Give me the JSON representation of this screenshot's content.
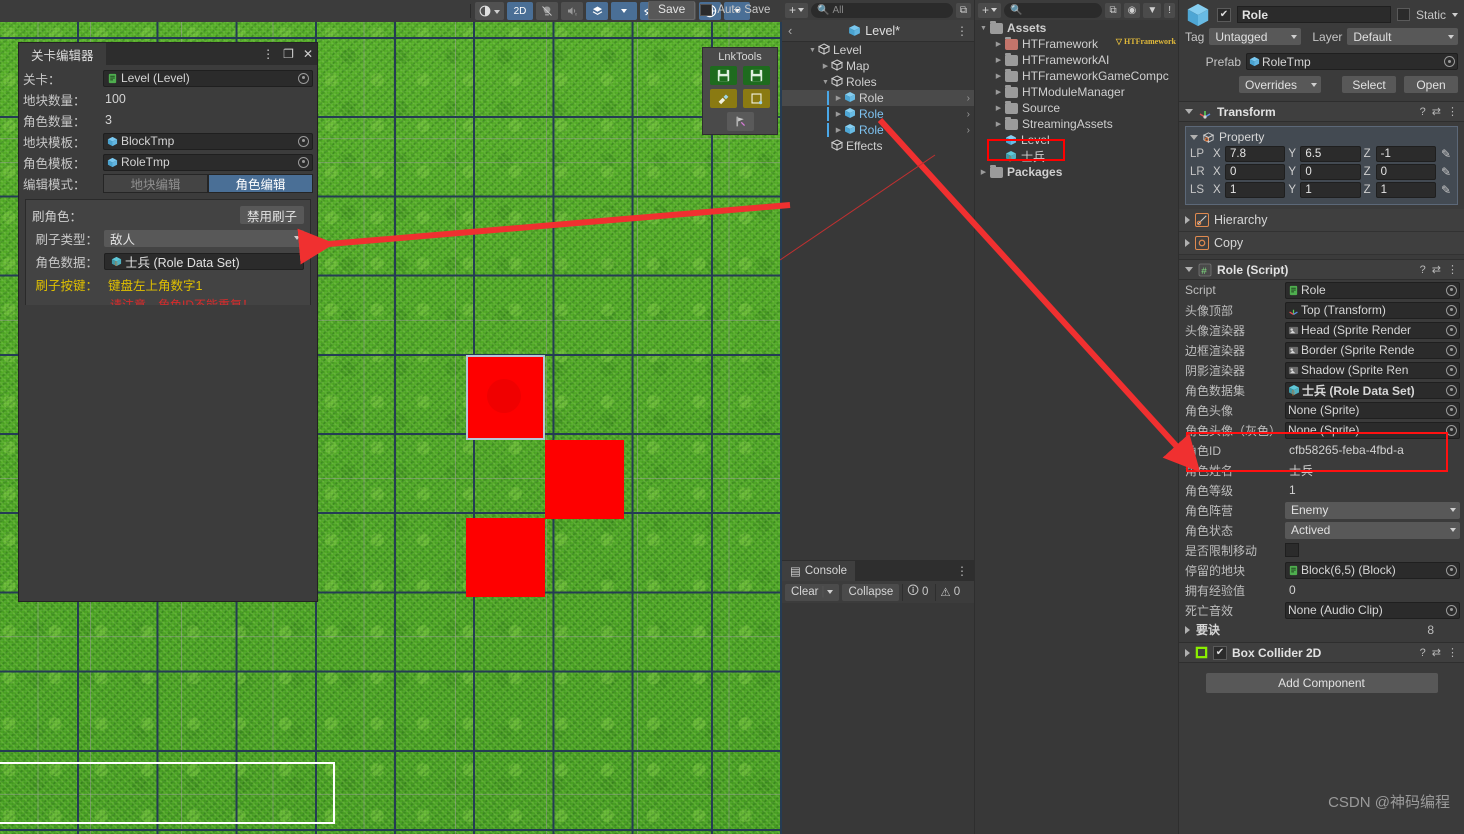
{
  "scene_toolbar": {
    "save_label": "Save",
    "autosave_label": "Auto Save",
    "mode_2d": "2D",
    "buttons": [
      "light-toggle",
      "audio-toggle",
      "effects-toggle",
      "visibility-toggle",
      "camera-toggle",
      "gizmos-toggle"
    ]
  },
  "lnktools": {
    "title": "LnkTools",
    "buttons": [
      "save-icon",
      "save-as-icon",
      "brush-icon",
      "frame-icon",
      "flag-icon"
    ]
  },
  "level_editor": {
    "title": "关卡编辑器",
    "window_controls": [
      "more-menu-icon",
      "maximize-icon",
      "close-icon"
    ],
    "fields": [
      {
        "label": "关卡：",
        "value": "Level (Level)",
        "type": "object",
        "icon": "script-icon"
      },
      {
        "label": "地块数量：",
        "value": "100",
        "type": "text"
      },
      {
        "label": "角色数量：",
        "value": "3",
        "type": "text"
      },
      {
        "label": "地块模板：",
        "value": "BlockTmp",
        "type": "object",
        "icon": "prefab-icon"
      },
      {
        "label": "角色模板：",
        "value": "RoleTmp",
        "type": "object",
        "icon": "prefab-icon"
      }
    ],
    "edit_mode_label": "编辑模式：",
    "mode_tile": "地块编辑",
    "mode_role": "角色编辑",
    "brush": {
      "title": "刷角色：",
      "disable_button": "禁用刷子",
      "type_label": "刷子类型：",
      "type_value": "敌人",
      "data_label": "角色数据：",
      "data_value": "士兵 (Role Data Set)",
      "key_label": "刷子按键：",
      "key_value": "键盘左上角数字1",
      "warning": "请注意，角色ID不能重复！"
    }
  },
  "hierarchy": {
    "header_title": "Level*",
    "search_placeholder": "All",
    "items": [
      {
        "label": "Level",
        "indent": 1,
        "expanded": true,
        "blue": false,
        "selected": false,
        "mark": false,
        "chevron": false
      },
      {
        "label": "Map",
        "indent": 2,
        "expanded": false,
        "blue": false,
        "selected": false,
        "mark": false,
        "chevron": false
      },
      {
        "label": "Roles",
        "indent": 2,
        "expanded": true,
        "blue": false,
        "selected": false,
        "mark": false,
        "chevron": false
      },
      {
        "label": "Role",
        "indent": 3,
        "expanded": false,
        "blue": false,
        "selected": true,
        "mark": true,
        "chevron": true
      },
      {
        "label": "Role",
        "indent": 3,
        "expanded": false,
        "blue": true,
        "selected": false,
        "mark": true,
        "chevron": true
      },
      {
        "label": "Role",
        "indent": 3,
        "expanded": false,
        "blue": true,
        "selected": false,
        "mark": true,
        "chevron": true
      },
      {
        "label": "Effects",
        "indent": 2,
        "expanded": null,
        "blue": false,
        "selected": false,
        "mark": false,
        "chevron": false
      }
    ]
  },
  "project": {
    "items": [
      {
        "label": "Assets",
        "indent": 0,
        "kind": "folder",
        "expanded": true,
        "badge": ""
      },
      {
        "label": "HTFramework",
        "indent": 1,
        "kind": "folder-ht",
        "expanded": false,
        "badge": "HTFramework"
      },
      {
        "label": "HTFrameworkAI",
        "indent": 1,
        "kind": "folder",
        "expanded": false,
        "badge": ""
      },
      {
        "label": "HTFrameworkGameCompc",
        "indent": 1,
        "kind": "folder",
        "expanded": false,
        "badge": ""
      },
      {
        "label": "HTModuleManager",
        "indent": 1,
        "kind": "folder",
        "expanded": false,
        "badge": ""
      },
      {
        "label": "Source",
        "indent": 1,
        "kind": "folder",
        "expanded": false,
        "badge": ""
      },
      {
        "label": "StreamingAssets",
        "indent": 1,
        "kind": "folder",
        "expanded": false,
        "badge": ""
      },
      {
        "label": "Level",
        "indent": 1,
        "kind": "prefab",
        "expanded": null,
        "badge": ""
      },
      {
        "label": "士兵",
        "indent": 1,
        "kind": "asset",
        "expanded": null,
        "badge": ""
      },
      {
        "label": "Packages",
        "indent": 0,
        "kind": "folder",
        "expanded": false,
        "badge": ""
      }
    ]
  },
  "console": {
    "tab_label": "Console",
    "clear_label": "Clear",
    "collapse_label": "Collapse",
    "error_count": "0",
    "warning_count": "0"
  },
  "inspector": {
    "object_name": "Role",
    "static_label": "Static",
    "tag_label": "Tag",
    "tag_value": "Untagged",
    "layer_label": "Layer",
    "layer_value": "Default",
    "prefab_label": "Prefab",
    "prefab_value": "RoleTmp",
    "overrides_label": "Overrides",
    "select_label": "Select",
    "open_label": "Open",
    "transform": {
      "title": "Transform",
      "property_label": "Property",
      "rows": [
        {
          "label": "LP",
          "x": "7.8",
          "y": "6.5",
          "z": "-1"
        },
        {
          "label": "LR",
          "x": "0",
          "y": "0",
          "z": "0"
        },
        {
          "label": "LS",
          "x": "1",
          "y": "1",
          "z": "1"
        }
      ]
    },
    "folds": [
      {
        "label": "Hierarchy"
      },
      {
        "label": "Copy"
      }
    ],
    "role_script": {
      "title": "Role (Script)",
      "rows": [
        {
          "label": "Script",
          "value": "Role",
          "type": "object",
          "icon": "script-icon"
        },
        {
          "label": "头像顶部",
          "value": "Top (Transform)",
          "type": "object",
          "icon": "transform-icon"
        },
        {
          "label": "头像渲染器",
          "value": "Head (Sprite Render",
          "type": "object",
          "icon": "sprite-icon"
        },
        {
          "label": "边框渲染器",
          "value": "Border (Sprite Rende",
          "type": "object",
          "icon": "sprite-icon"
        },
        {
          "label": "阴影渲染器",
          "value": "Shadow (Sprite Ren",
          "type": "object",
          "icon": "sprite-icon"
        },
        {
          "label": "角色数据集",
          "value": "士兵 (Role Data Set)",
          "type": "object",
          "icon": "asset-icon",
          "bold": true
        },
        {
          "label": "角色头像",
          "value": "None (Sprite)",
          "type": "object",
          "icon": ""
        },
        {
          "label": "角色头像（灰色）",
          "value": "None (Sprite)",
          "type": "object",
          "icon": ""
        },
        {
          "label": "角色ID",
          "value": "cfb58265-feba-4fbd-a",
          "type": "text"
        },
        {
          "label": "角色姓名",
          "value": "士兵",
          "type": "text"
        },
        {
          "label": "角色等级",
          "value": "1",
          "type": "text"
        },
        {
          "label": "角色阵营",
          "value": "Enemy",
          "type": "dropdown"
        },
        {
          "label": "角色状态",
          "value": "Actived",
          "type": "dropdown"
        },
        {
          "label": "是否限制移动",
          "value": "",
          "type": "checkbox"
        },
        {
          "label": "停留的地块",
          "value": "Block(6,5) (Block)",
          "type": "object",
          "icon": "script-icon"
        },
        {
          "label": "拥有经验值",
          "value": "0",
          "type": "text"
        },
        {
          "label": "死亡音效",
          "value": "None (Audio Clip)",
          "type": "object",
          "icon": ""
        }
      ],
      "array_label": "要诀",
      "array_size": "8"
    },
    "box_collider": {
      "title": "Box Collider 2D"
    },
    "add_component_label": "Add Component"
  },
  "watermark": "CSDN @神码编程",
  "colors": {
    "accent_blue": "#4a6f96",
    "red": "#ff0000",
    "warn_yellow": "#e0c000",
    "error_red": "#d82b2b",
    "grass_green": "#4da524"
  }
}
